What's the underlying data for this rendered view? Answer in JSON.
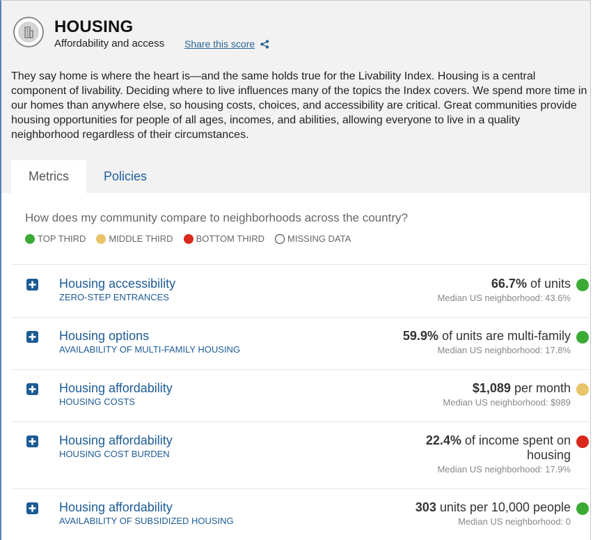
{
  "header": {
    "title": "HOUSING",
    "subtitle": "Affordability and access",
    "share_label": "Share this score"
  },
  "intro": "They say home is where the heart is—and the same holds true for the Livability Index. Housing is a central component of livability. Deciding where to live influences many of the topics the Index covers. We spend more time in our homes than anywhere else, so housing costs, choices, and accessibility are critical. Great communities provide housing opportunities for people of all ages, incomes, and abilities, allowing everyone to live in a quality neighborhood regardless of their circumstances.",
  "tabs": [
    {
      "label": "Metrics",
      "active": true
    },
    {
      "label": "Policies",
      "active": false
    }
  ],
  "question": "How does my community compare to neighborhoods across the country?",
  "legend": [
    {
      "label": "TOP THIRD",
      "color": "#3aaa35"
    },
    {
      "label": "MIDDLE THIRD",
      "color": "#e8c46a"
    },
    {
      "label": "BOTTOM THIRD",
      "color": "#d9291c"
    },
    {
      "label": "MISSING DATA",
      "color": "#ffffff"
    }
  ],
  "metrics": [
    {
      "name": "Housing accessibility",
      "sub": "ZERO-STEP ENTRANCES",
      "value_bold": "66.7%",
      "value_line1": " of units",
      "value_line2": "",
      "median": "Median US neighborhood: 43.6%",
      "status_color": "#3aaa35"
    },
    {
      "name": "Housing options",
      "sub": "AVAILABILITY OF MULTI-FAMILY HOUSING",
      "value_bold": "59.9%",
      "value_line1": " of units are multi-family",
      "value_line2": "",
      "median": "Median US neighborhood: 17.8%",
      "status_color": "#3aaa35"
    },
    {
      "name": "Housing affordability",
      "sub": "HOUSING COSTS",
      "value_bold": "$1,089",
      "value_line1": " per month",
      "value_line2": "",
      "median": "Median US neighborhood: $989",
      "status_color": "#e8c46a"
    },
    {
      "name": "Housing affordability",
      "sub": "HOUSING COST BURDEN",
      "value_bold": "22.4%",
      "value_line1": " of income spent on",
      "value_line2": "housing",
      "median": "Median US neighborhood: 17.9%",
      "status_color": "#d9291c"
    },
    {
      "name": "Housing affordability",
      "sub": "AVAILABILITY OF SUBSIDIZED HOUSING",
      "value_bold": "303",
      "value_line1": " units per 10,000 people",
      "value_line2": "",
      "median": "Median US neighborhood: 0",
      "status_color": "#3aaa35"
    }
  ],
  "icons": {
    "logo": "building-icon",
    "share": "share-icon",
    "expand": "plus-icon"
  }
}
